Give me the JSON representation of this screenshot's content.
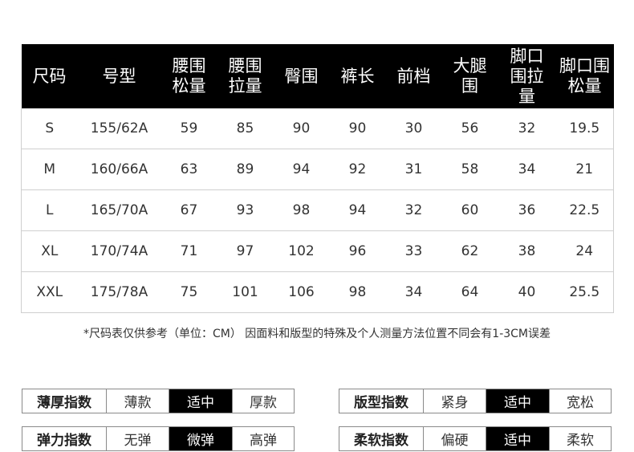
{
  "table": {
    "headers": [
      "尺码",
      "号型",
      "腰围松量",
      "腰围拉量",
      "臀围",
      "裤长",
      "前档",
      "大腿围",
      "脚口围拉量",
      "脚口围松量"
    ],
    "rows": [
      [
        "S",
        "155/62A",
        "59",
        "85",
        "90",
        "90",
        "30",
        "56",
        "32",
        "19.5"
      ],
      [
        "M",
        "160/66A",
        "63",
        "89",
        "94",
        "92",
        "31",
        "58",
        "34",
        "21"
      ],
      [
        "L",
        "165/70A",
        "67",
        "93",
        "98",
        "94",
        "32",
        "60",
        "36",
        "22.5"
      ],
      [
        "XL",
        "170/74A",
        "71",
        "97",
        "102",
        "96",
        "33",
        "62",
        "38",
        "24"
      ],
      [
        "XXL",
        "175/78A",
        "75",
        "101",
        "106",
        "98",
        "34",
        "64",
        "40",
        "25.5"
      ]
    ]
  },
  "note": "*尺码表仅供参考（单位：CM） 因面料和版型的特殊及个人测量方法位置不同会有1-3CM误差",
  "indices": {
    "thickness": {
      "label": "薄厚指数",
      "options": [
        "薄款",
        "适中",
        "厚款"
      ],
      "selected": 1
    },
    "fit": {
      "label": "版型指数",
      "options": [
        "紧身",
        "适中",
        "宽松"
      ],
      "selected": 1
    },
    "elasticity": {
      "label": "弹力指数",
      "options": [
        "无弹",
        "微弹",
        "高弹"
      ],
      "selected": 1
    },
    "softness": {
      "label": "柔软指数",
      "options": [
        "偏硬",
        "适中",
        "柔软"
      ],
      "selected": 1
    }
  },
  "colors": {
    "header_bg": "#000000",
    "header_text": "#ffffff",
    "active_bg": "#000000",
    "border": "#8a8a8a"
  }
}
